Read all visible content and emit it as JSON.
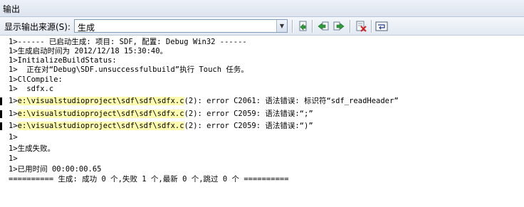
{
  "window": {
    "title": "输出"
  },
  "toolbar": {
    "source_label": "显示输出来源(S):",
    "source_value": "生成",
    "buttons": [
      {
        "name": "goto-location-button",
        "icon": "goto-location-icon"
      },
      {
        "name": "prev-message-button",
        "icon": "prev-message-icon"
      },
      {
        "name": "next-message-button",
        "icon": "next-message-icon"
      },
      {
        "name": "clear-all-button",
        "icon": "clear-all-icon"
      },
      {
        "name": "toggle-wordwrap-button",
        "icon": "wordwrap-icon"
      }
    ]
  },
  "output": {
    "lines": [
      {
        "text": "1>------ 已启动生成: 项目: SDF, 配置: Debug Win32 ------"
      },
      {
        "text": "1>生成启动时间为 2012/12/18 15:30:40。"
      },
      {
        "text": "1>InitializeBuildStatus:"
      },
      {
        "text": "1>  正在对“Debug\\SDF.unsuccessfulbuild”执行 Touch 任务。"
      },
      {
        "text": "1>ClCompile:"
      },
      {
        "text": "1>  sdfx.c"
      },
      {
        "prefix": "1>",
        "path": "e:\\visualstudioproject\\sdf\\sdf\\sdfx.c",
        "rest": "(2): error C2061: 语法错误: 标识符“sdf_readHeader”"
      },
      {
        "prefix": "1>",
        "path": "e:\\visualstudioproject\\sdf\\sdf\\sdfx.c",
        "rest": "(2): error C2059: 语法错误:“;”"
      },
      {
        "prefix": "1>",
        "path": "e:\\visualstudioproject\\sdf\\sdf\\sdfx.c",
        "rest": "(2): error C2059: 语法错误:“)”"
      },
      {
        "text": "1>"
      },
      {
        "text": "1>生成失败。"
      },
      {
        "text": "1>"
      },
      {
        "text": "1>已用时间 00:00:00.65"
      },
      {
        "text": "========== 生成: 成功 0 个,失败 1 个,最新 0 个,跳过 0 个 =========="
      }
    ]
  },
  "colors": {
    "highlight": "#fffcb0",
    "toolbar_bg": "#e3e9f2",
    "border": "#7f9db9"
  }
}
